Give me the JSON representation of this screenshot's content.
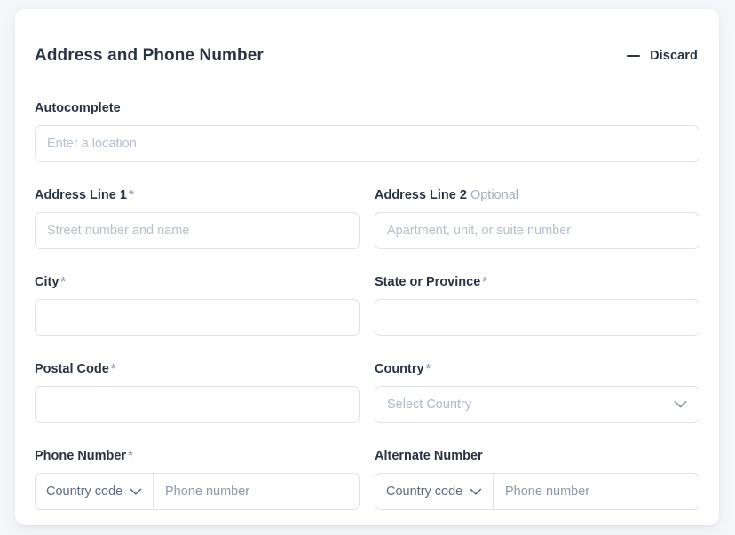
{
  "header": {
    "title": "Address and Phone Number",
    "discard_label": "Discard",
    "discard_icon": "minus-icon"
  },
  "colors": {
    "page_background": "#f4f6f9",
    "card_background": "#ffffff",
    "text": "#2a3342",
    "label_required_asterisk": "#9aa6bb",
    "optional_text": "#a5adbb",
    "placeholder": "#b7bfcc",
    "input_border": "#dee2e9"
  },
  "form": {
    "autocomplete": {
      "label": "Autocomplete",
      "placeholder": "Enter a location",
      "value": ""
    },
    "address_line_1": {
      "label": "Address Line 1",
      "required_marker": "*",
      "placeholder": "Street number and name",
      "value": ""
    },
    "address_line_2": {
      "label": "Address Line 2",
      "optional_marker": "Optional",
      "placeholder": "Apartment, unit, or suite number",
      "value": ""
    },
    "city": {
      "label": "City",
      "required_marker": "*",
      "placeholder": "",
      "value": ""
    },
    "state": {
      "label": "State or Province",
      "required_marker": "*",
      "placeholder": "",
      "value": ""
    },
    "postal_code": {
      "label": "Postal Code",
      "required_marker": "*",
      "placeholder": "",
      "value": ""
    },
    "country": {
      "label": "Country",
      "required_marker": "*",
      "selected": "Select Country",
      "chevron_icon": "chevron-down-icon"
    },
    "phone_number": {
      "label": "Phone Number",
      "required_marker": "*",
      "country_code_selected": "Country code",
      "country_code_chevron": "chevron-down-icon",
      "placeholder": "Phone number",
      "value": ""
    },
    "alternate_number": {
      "label": "Alternate Number",
      "country_code_selected": "Country code",
      "country_code_chevron": "chevron-down-icon",
      "placeholder": "Phone number",
      "value": ""
    }
  }
}
